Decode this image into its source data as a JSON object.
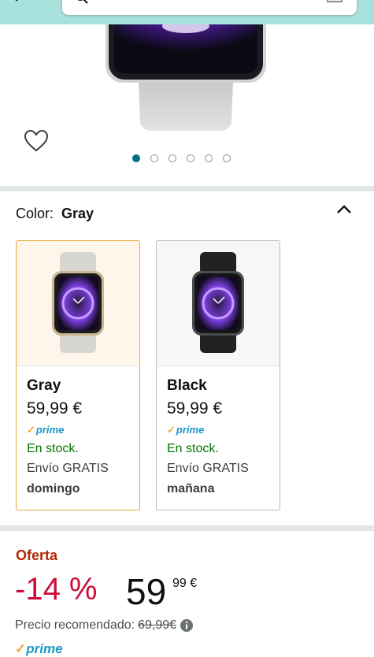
{
  "colors": {
    "accent": "#007185",
    "offer": "#b12704",
    "discount": "#cc0c39",
    "stock": "#007600",
    "prime": "#1a98c9",
    "selected_border": "#e8a637"
  },
  "header": {
    "icons": [
      "back-arrow-icon",
      "search-icon",
      "camera-icon"
    ]
  },
  "gallery": {
    "dots_total": 6,
    "active_dot": 1,
    "icons": [
      "heart-icon"
    ]
  },
  "color_selector": {
    "label": "Color:",
    "selected": "Gray",
    "options": [
      {
        "name": "Gray",
        "price": "59,99 €",
        "prime": "prime",
        "stock": "En stock.",
        "shipping": "Envío GRATIS",
        "delivery_day": "domingo"
      },
      {
        "name": "Black",
        "price": "59,99 €",
        "prime": "prime",
        "stock": "En stock.",
        "shipping": "Envío GRATIS",
        "delivery_day": "mañana"
      }
    ]
  },
  "offer": {
    "label": "Oferta",
    "discount": "-14 %",
    "price_whole": "59",
    "price_fraction": "99 €",
    "rrp_label": "Precio recomendado:",
    "rrp_value": "69,99€",
    "prime": "prime"
  }
}
